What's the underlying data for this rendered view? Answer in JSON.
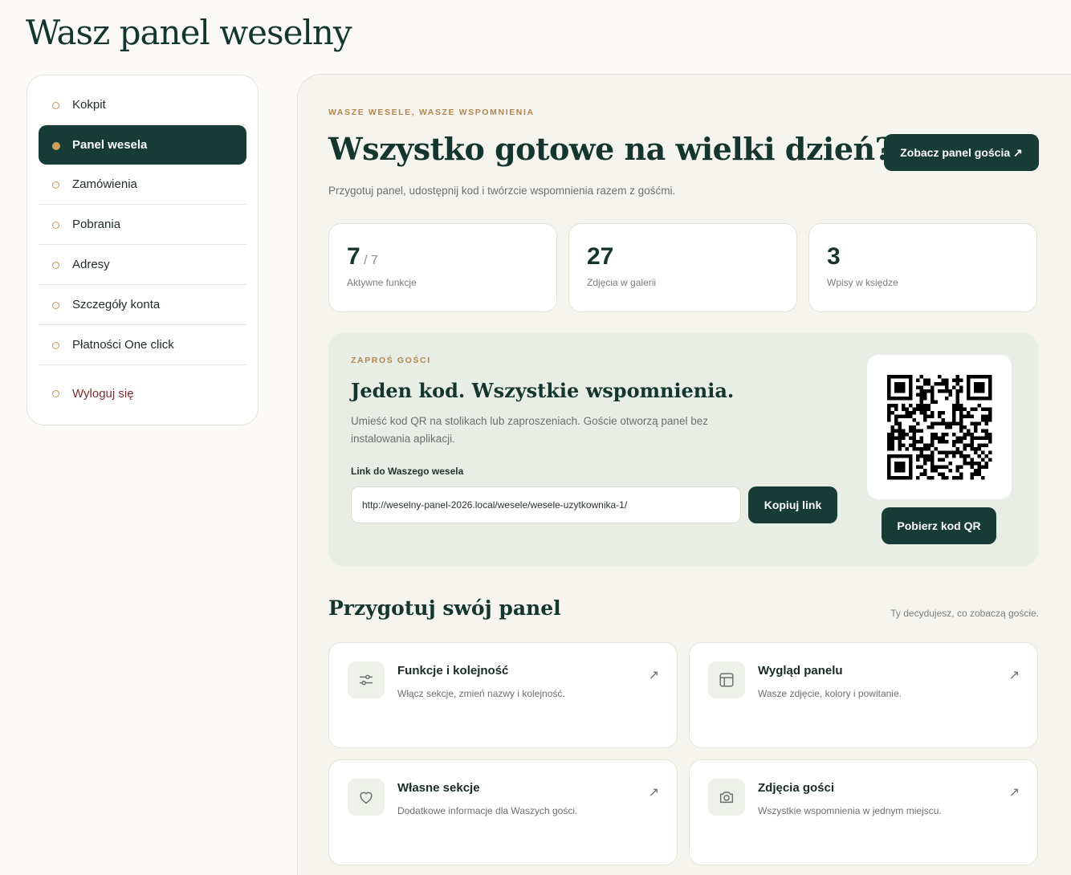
{
  "page": {
    "title": "Wasz panel weselny"
  },
  "sidebar": {
    "items": [
      {
        "label": "Kokpit"
      },
      {
        "label": "Panel wesela",
        "active": true
      },
      {
        "label": "Zamówienia"
      },
      {
        "label": "Pobrania"
      },
      {
        "label": "Adresy"
      },
      {
        "label": "Szczegóły konta"
      },
      {
        "label": "Płatności One click"
      },
      {
        "label": "Wyloguj się"
      }
    ]
  },
  "hero": {
    "eyebrow": "WASZE WESELE, WASZE WSPOMNIENIA",
    "title": "Wszystko gotowe na wielki dzień?",
    "subtitle": "Przygotuj panel, udostępnij kod i twórzcie wspomnienia razem z gośćmi.",
    "guest_panel_button": "Zobacz panel gościa ↗"
  },
  "stats": [
    {
      "value": "7",
      "total": "/ 7",
      "label": "Aktywne funkcje"
    },
    {
      "value": "27",
      "total": "",
      "label": "Zdjęcia w galerii"
    },
    {
      "value": "3",
      "total": "",
      "label": "Wpisy w księdze"
    }
  ],
  "invite": {
    "eyebrow": "ZAPROŚ GOŚCI",
    "title": "Jeden kod. Wszystkie wspomnienia.",
    "description": "Umieść kod QR na stolikach lub zaproszeniach. Goście otworzą panel bez instalowania aplikacji.",
    "link_label": "Link do Waszego wesela",
    "link_value": "http://weselny-panel-2026.local/wesele/wesele-uzytkownika-1/",
    "copy_button": "Kopiuj link",
    "download_qr_button": "Pobierz kod QR"
  },
  "panel_section": {
    "title": "Przygotuj swój panel",
    "note": "Ty decydujesz, co zobaczą goście.",
    "cards": [
      {
        "title": "Funkcje i kolejność",
        "desc": "Włącz sekcje, zmień nazwy i kolejność.",
        "icon": "sliders-icon"
      },
      {
        "title": "Wygląd panelu",
        "desc": "Wasze zdjęcie, kolory i powitanie.",
        "icon": "layout-icon"
      },
      {
        "title": "Własne sekcje",
        "desc": "Dodatkowe informacje dla Waszych gości.",
        "icon": "heart-icon"
      },
      {
        "title": "Zdjęcia gości",
        "desc": "Wszystkie wspomnienia w jednym miejscu.",
        "icon": "camera-icon"
      }
    ],
    "arrow": "↗"
  },
  "colors": {
    "accent": "#163c35",
    "gold": "#b3874c",
    "logout": "#7a2e2e"
  }
}
